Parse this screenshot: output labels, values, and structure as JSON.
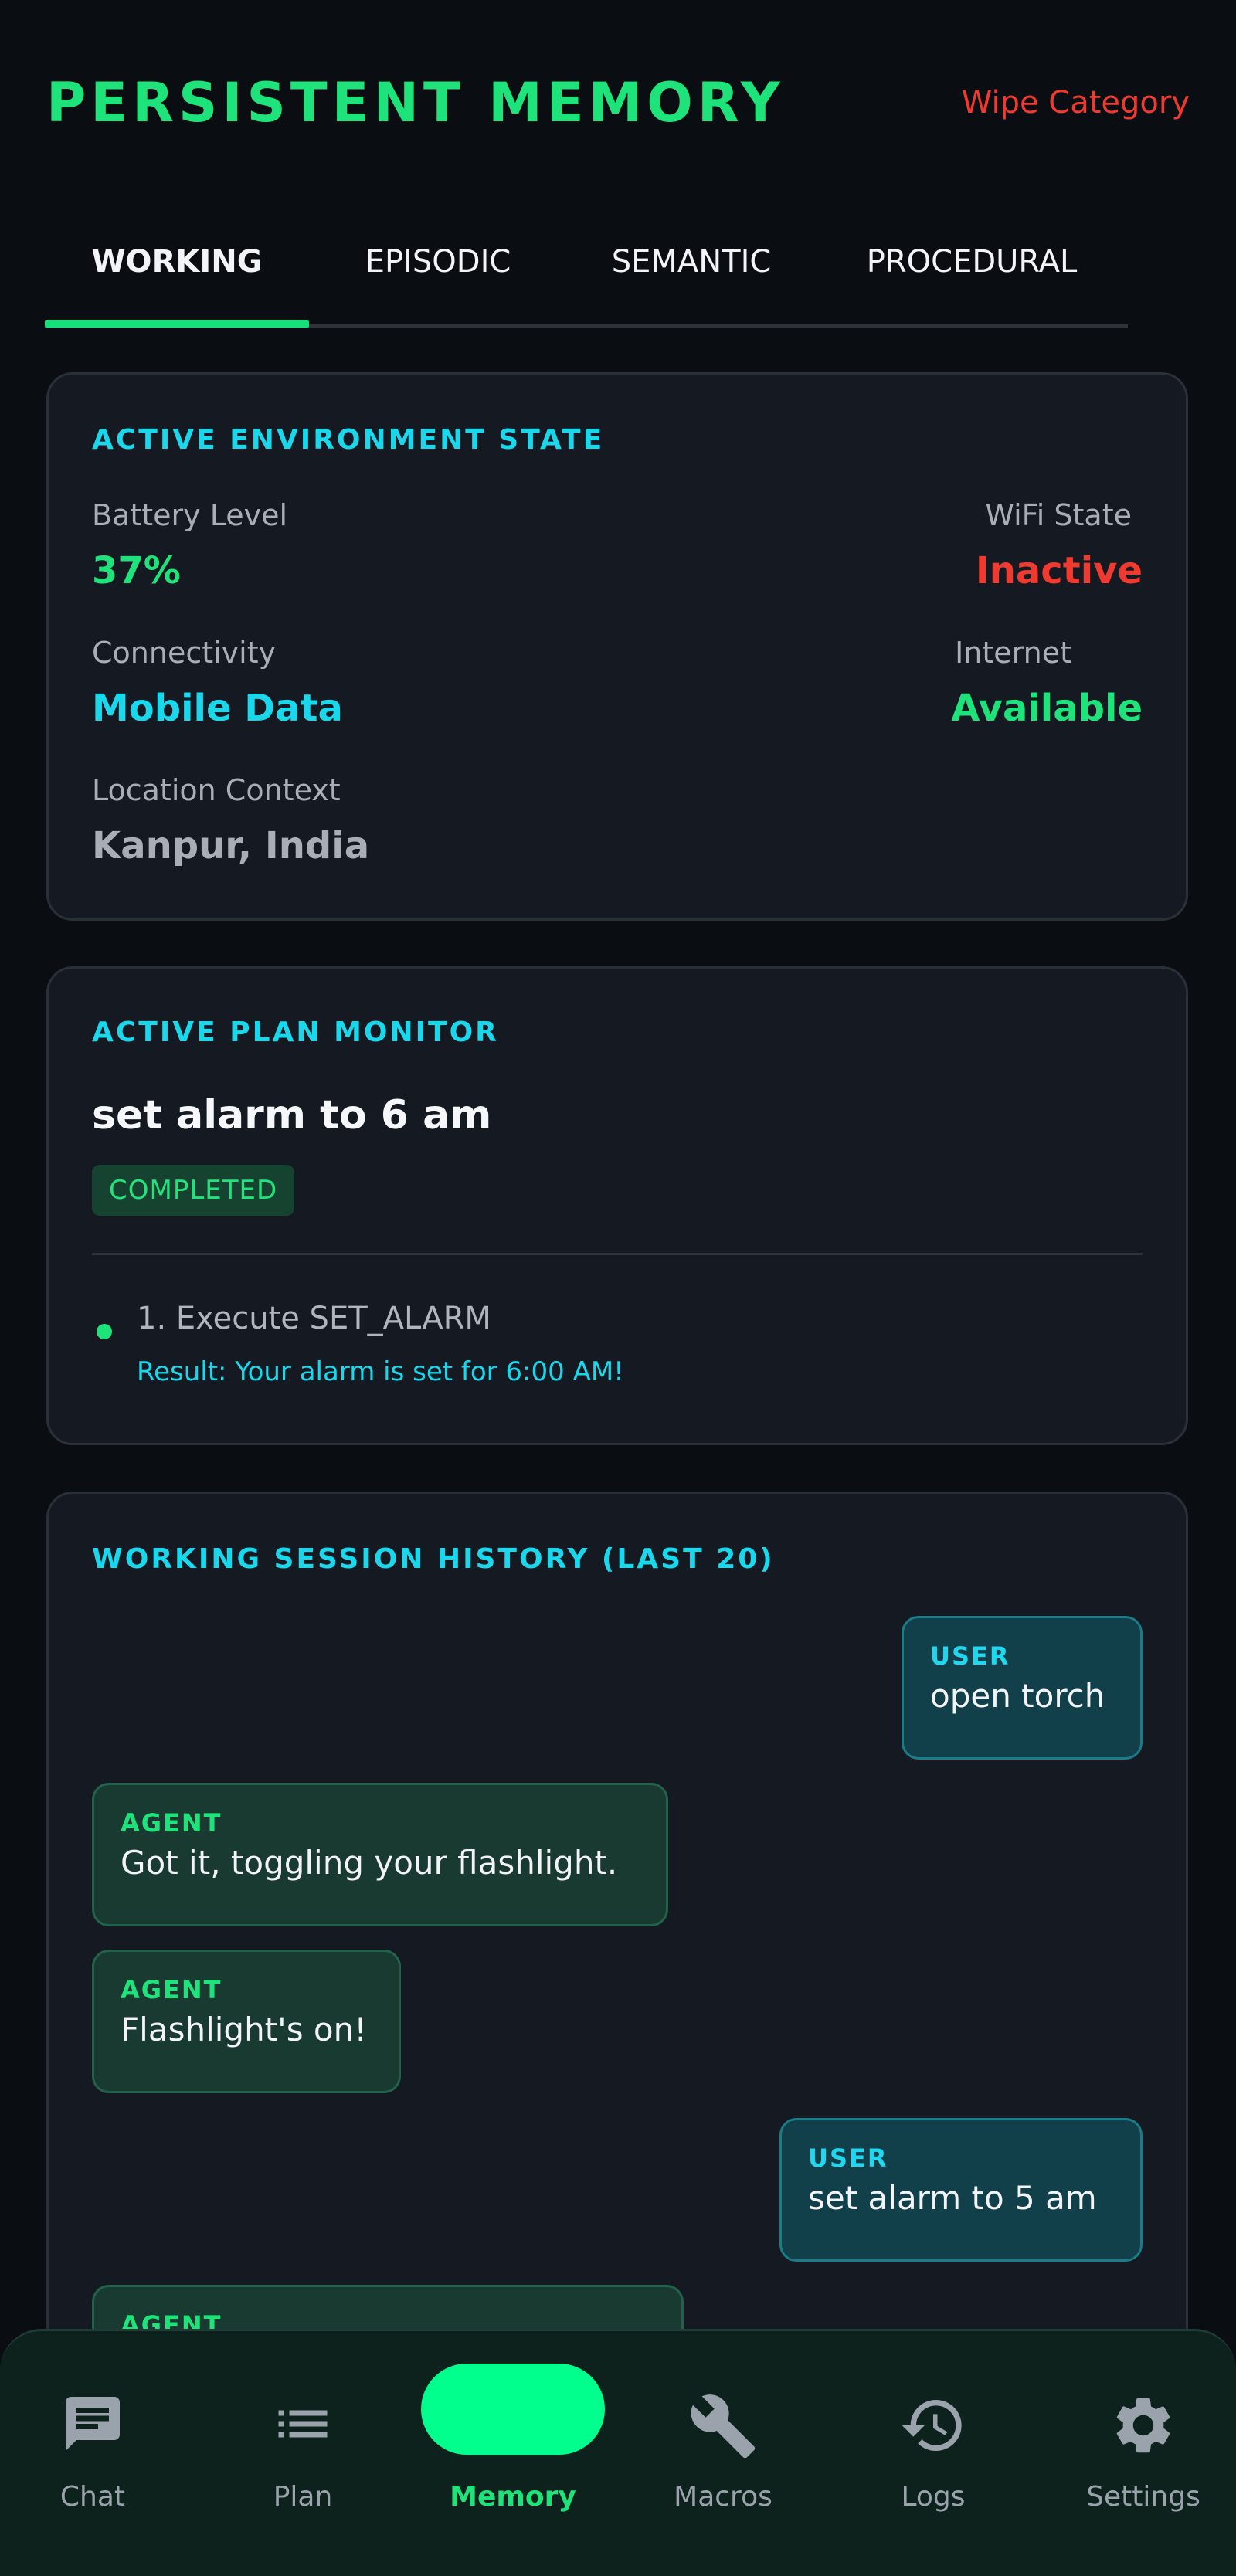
{
  "header": {
    "title": "PERSISTENT MEMORY",
    "wipe_label": "Wipe Category"
  },
  "tabs": [
    {
      "label": "WORKING",
      "active": true
    },
    {
      "label": "EPISODIC",
      "active": false
    },
    {
      "label": "SEMANTIC",
      "active": false
    },
    {
      "label": "PROCEDURAL",
      "active": false
    }
  ],
  "environment": {
    "title": "ACTIVE ENVIRONMENT STATE",
    "battery_label": "Battery Level",
    "battery_value": "37%",
    "wifi_label": "WiFi State",
    "wifi_value": "Inactive",
    "connectivity_label": "Connectivity",
    "connectivity_value": "Mobile Data",
    "internet_label": "Internet",
    "internet_value": "Available",
    "location_label": "Location Context",
    "location_value": "Kanpur, India"
  },
  "plan": {
    "title": "ACTIVE PLAN MONITOR",
    "name": "set alarm to 6 am",
    "status": "COMPLETED",
    "steps": [
      {
        "label": "1. Execute SET_ALARM",
        "result": "Result: Your alarm is set for 6:00 AM!"
      }
    ]
  },
  "history": {
    "title": "WORKING SESSION HISTORY (LAST 20)",
    "messages": [
      {
        "role": "USER",
        "text": "open torch"
      },
      {
        "role": "AGENT",
        "text": "Got it, toggling your flashlight."
      },
      {
        "role": "AGENT",
        "text": "Flashlight's on!"
      },
      {
        "role": "USER",
        "text": "set alarm to 5 am"
      },
      {
        "role": "AGENT",
        "text": ""
      }
    ]
  },
  "nav": [
    {
      "label": "Chat",
      "icon": "chat-icon",
      "active": false
    },
    {
      "label": "Plan",
      "icon": "list-icon",
      "active": false
    },
    {
      "label": "Memory",
      "icon": "memory-icon",
      "active": true
    },
    {
      "label": "Macros",
      "icon": "wrench-icon",
      "active": false
    },
    {
      "label": "Logs",
      "icon": "history-icon",
      "active": false
    },
    {
      "label": "Settings",
      "icon": "gear-icon",
      "active": false
    }
  ],
  "colors": {
    "accent_green": "#1ee37b",
    "accent_cyan": "#19d8ec",
    "danger_red": "#f0392f",
    "background": "#0a0d12",
    "card": "#151a22"
  }
}
